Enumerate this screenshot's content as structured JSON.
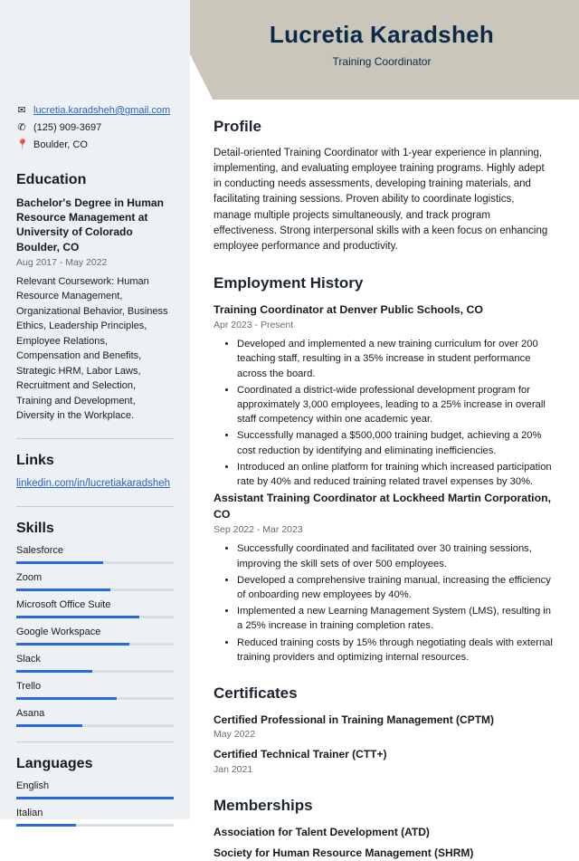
{
  "name": "Lucretia Karadsheh",
  "title": "Training Coordinator",
  "contact": {
    "email": "lucretia.karadsheh@gmail.com",
    "phone": "(125) 909-3697",
    "location": "Boulder, CO"
  },
  "education": {
    "heading": "Education",
    "degree": "Bachelor's Degree in Human Resource Management at University of Colorado Boulder, CO",
    "dates": "Aug 2017 - May 2022",
    "body": "Relevant Coursework: Human Resource Management, Organizational Behavior, Business Ethics, Leadership Principles, Employee Relations, Compensation and Benefits, Strategic HRM, Labor Laws, Recruitment and Selection, Training and Development, Diversity in the Workplace."
  },
  "links": {
    "heading": "Links",
    "items": [
      {
        "text": "linkedin.com/in/lucretiakaradsheh"
      }
    ]
  },
  "skills": {
    "heading": "Skills",
    "items": [
      {
        "name": "Salesforce",
        "level": 55
      },
      {
        "name": "Zoom",
        "level": 60
      },
      {
        "name": "Microsoft Office Suite",
        "level": 78
      },
      {
        "name": "Google Workspace",
        "level": 72
      },
      {
        "name": "Slack",
        "level": 48
      },
      {
        "name": "Trello",
        "level": 64
      },
      {
        "name": "Asana",
        "level": 42
      }
    ]
  },
  "languages": {
    "heading": "Languages",
    "items": [
      {
        "name": "English",
        "level": 100
      },
      {
        "name": "Italian",
        "level": 38
      }
    ]
  },
  "profile": {
    "heading": "Profile",
    "body": "Detail-oriented Training Coordinator with 1-year experience in planning, implementing, and evaluating employee training programs. Highly adept in conducting needs assessments, developing training materials, and facilitating training sessions. Proven ability to coordinate logistics, manage multiple projects simultaneously, and track program effectiveness. Strong interpersonal skills with a keen focus on enhancing employee performance and productivity."
  },
  "employment": {
    "heading": "Employment History",
    "jobs": [
      {
        "title": "Training Coordinator at Denver Public Schools, CO",
        "dates": "Apr 2023 - Present",
        "bullets": [
          "Developed and implemented a new training curriculum for over 200 teaching staff, resulting in a 35% increase in student performance across the board.",
          "Coordinated a district-wide professional development program for approximately 3,000 employees, leading to a 25% increase in overall staff competency within one academic year.",
          "Successfully managed a $500,000 training budget, achieving a 20% cost reduction by identifying and eliminating inefficiencies.",
          "Introduced an online platform for training which increased participation rate by 40% and reduced training related travel expenses by 30%."
        ]
      },
      {
        "title": "Assistant Training Coordinator at Lockheed Martin Corporation, CO",
        "dates": "Sep 2022 - Mar 2023",
        "bullets": [
          "Successfully coordinated and facilitated over 30 training sessions, improving the skill sets of over 500 employees.",
          "Developed a comprehensive training manual, increasing the efficiency of onboarding new employees by 40%.",
          "Implemented a new Learning Management System (LMS), resulting in a 25% increase in training completion rates.",
          "Reduced training costs by 15% through negotiating deals with external training providers and optimizing internal resources."
        ]
      }
    ]
  },
  "certificates": {
    "heading": "Certificates",
    "items": [
      {
        "name": "Certified Professional in Training Management (CPTM)",
        "date": "May 2022"
      },
      {
        "name": "Certified Technical Trainer (CTT+)",
        "date": "Jan 2021"
      }
    ]
  },
  "memberships": {
    "heading": "Memberships",
    "items": [
      "Association for Talent Development (ATD)",
      "Society for Human Resource Management (SHRM)"
    ]
  }
}
